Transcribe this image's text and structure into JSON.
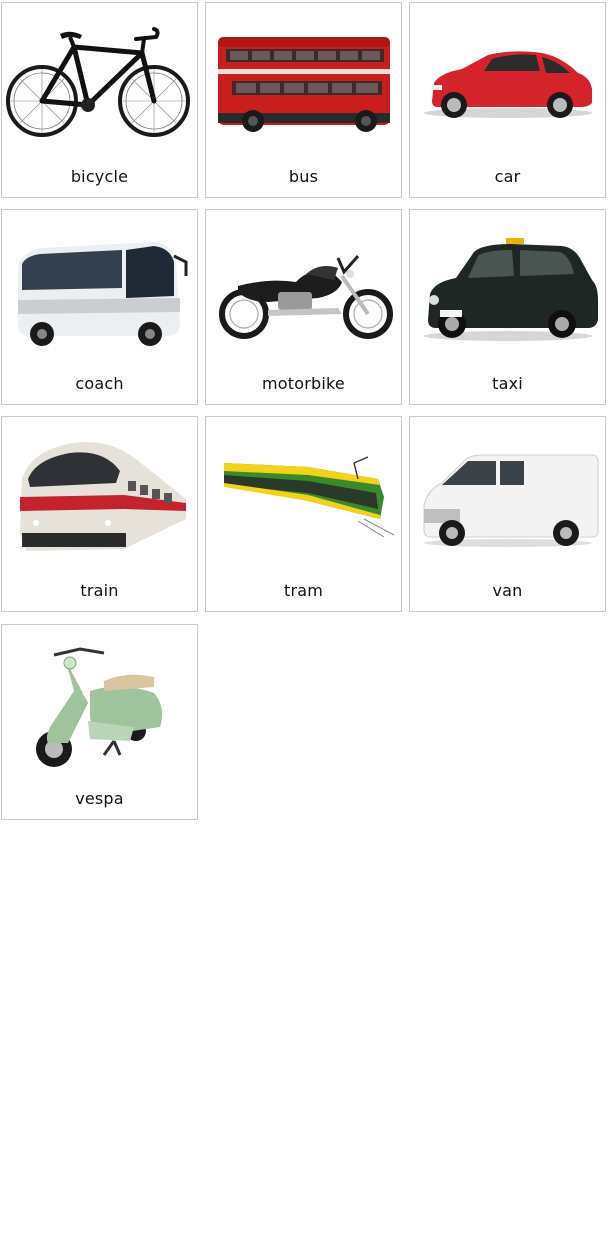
{
  "cards": [
    {
      "label": "bicycle"
    },
    {
      "label": "bus"
    },
    {
      "label": "car"
    },
    {
      "label": "coach"
    },
    {
      "label": "motorbike"
    },
    {
      "label": "taxi"
    },
    {
      "label": "train"
    },
    {
      "label": "tram"
    },
    {
      "label": "van"
    },
    {
      "label": "vespa"
    }
  ]
}
